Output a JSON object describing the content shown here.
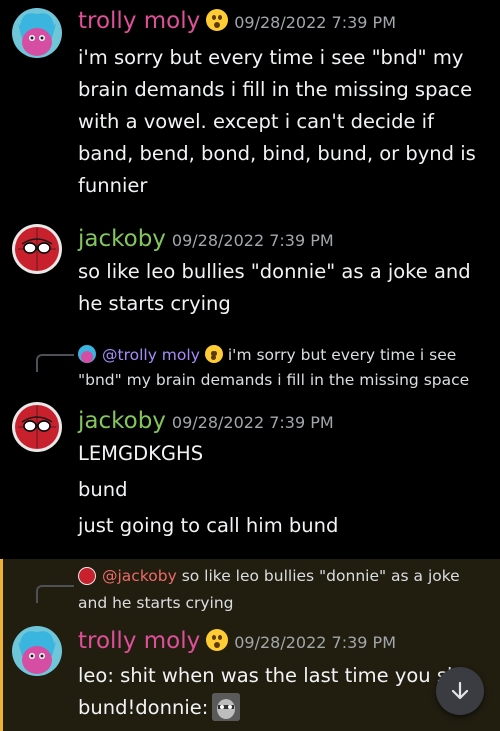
{
  "colors": {
    "trolly_name": "#e04f9a",
    "jackoby_name": "#84c65c",
    "highlight_bg": "#211e10",
    "highlight_bar": "#f0b232"
  },
  "messages": [
    {
      "username": "trolly moly",
      "timestamp": "09/28/2022 7:39 PM",
      "lines": [
        "i'm sorry but every time i see \"bnd\" my",
        "brain demands i fill in the missing space",
        "with a vowel. except i can't decide if",
        "band, bend, bond, bind, bund, or bynd is",
        "funnier"
      ]
    },
    {
      "username": "jackoby",
      "timestamp": "09/28/2022 7:39 PM",
      "lines": [
        "so like leo bullies \"donnie\" as a joke and",
        "he starts crying"
      ]
    },
    {
      "reply": {
        "mention": "@trolly moly",
        "text1": "i'm sorry but every time i see",
        "text2": "\"bnd\" my brain demands i fill in the missing space"
      },
      "username": "jackoby",
      "timestamp": "09/28/2022 7:39 PM",
      "lines": [
        "LEMGDKGHS",
        "bund",
        "just going to call him bund"
      ]
    },
    {
      "reply": {
        "mention": "@jackoby",
        "text1": "so like leo bullies \"donnie\" as a joke",
        "text2": "and he starts crying"
      },
      "username": "trolly moly",
      "timestamp": "09/28/2022 7:39 PM",
      "lines": [
        "leo: shit when was the last time you sl",
        "bund!donnie:"
      ]
    }
  ]
}
